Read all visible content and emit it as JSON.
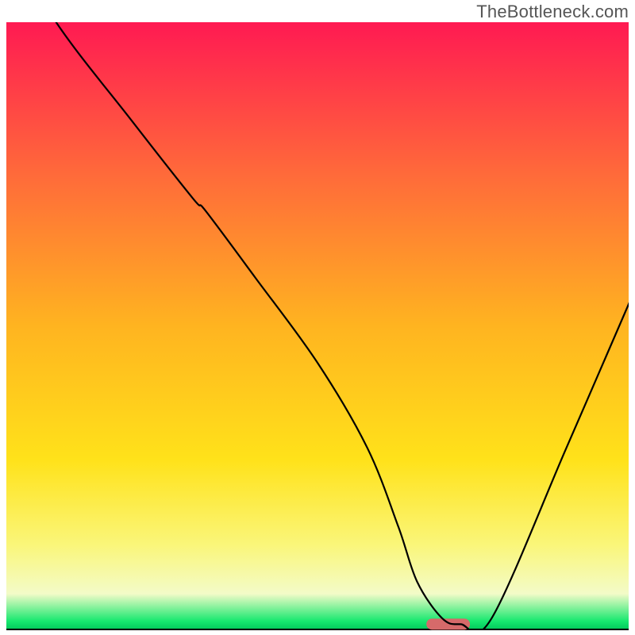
{
  "watermark": {
    "text": "TheBottleneck.com"
  },
  "chart_data": {
    "type": "line",
    "title": "",
    "xlabel": "",
    "ylabel": "",
    "xlim": [
      0,
      100
    ],
    "ylim": [
      0,
      100
    ],
    "grid": false,
    "legend": false,
    "background_gradient_stops": [
      {
        "offset": 0.0,
        "color": "#ff1a52"
      },
      {
        "offset": 0.25,
        "color": "#ff6a3a"
      },
      {
        "offset": 0.5,
        "color": "#ffb420"
      },
      {
        "offset": 0.72,
        "color": "#ffe21a"
      },
      {
        "offset": 0.86,
        "color": "#faf67a"
      },
      {
        "offset": 0.94,
        "color": "#f3fbc8"
      },
      {
        "offset": 0.985,
        "color": "#17e86f"
      },
      {
        "offset": 1.0,
        "color": "#00c55a"
      }
    ],
    "series": [
      {
        "name": "bottleneck-curve",
        "x": [
          -1,
          8,
          20,
          30,
          32,
          40,
          50,
          58,
          63,
          66,
          70,
          73,
          78,
          90,
          101
        ],
        "values": [
          116,
          100,
          84,
          71,
          69,
          58,
          44,
          30,
          17,
          8,
          2,
          1,
          2,
          30,
          56
        ]
      }
    ],
    "marker": {
      "name": "optimal-range",
      "x_center": 71,
      "x_halfwidth": 3.5,
      "y": 1,
      "color": "#d66a6a"
    },
    "axis_color": "#000000"
  }
}
